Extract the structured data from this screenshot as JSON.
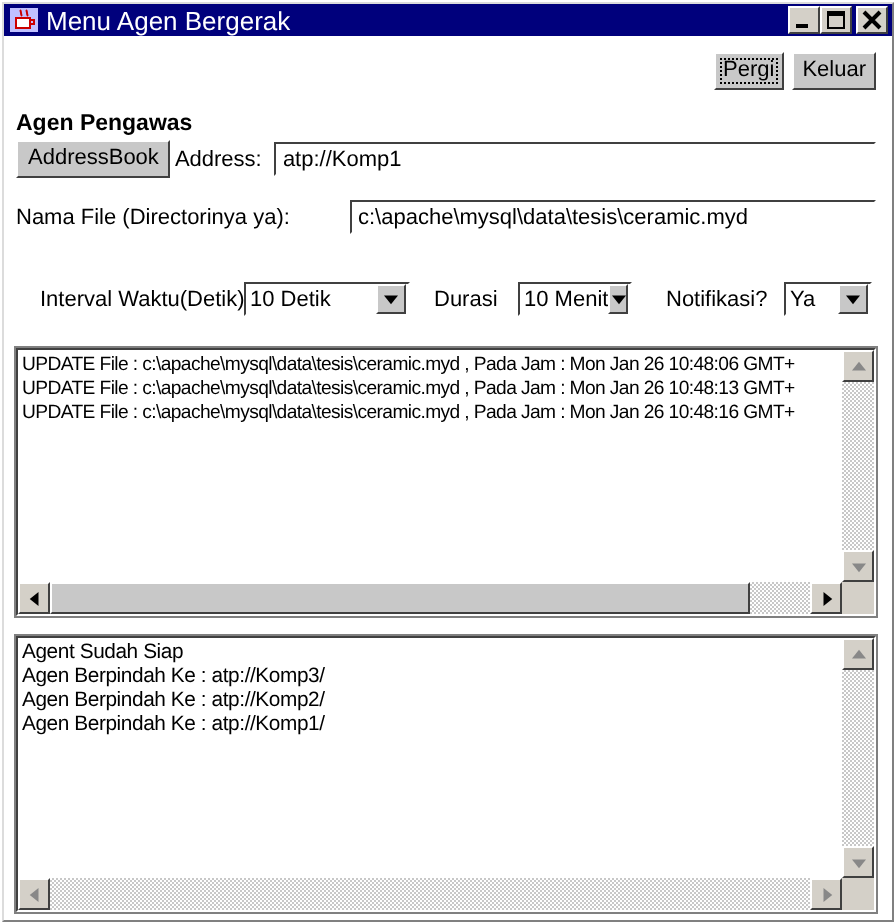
{
  "window": {
    "title": "Menu Agen Bergerak"
  },
  "buttons": [
    {
      "label": "Pergi",
      "focused": true
    },
    {
      "label": "Keluar",
      "focused": false
    }
  ],
  "section_title": "Agen Pengawas",
  "address": {
    "button": "AddressBook",
    "label": "Address:",
    "value": "atp://Komp1"
  },
  "file": {
    "label": "Nama File (Directorinya ya):",
    "value": "c:\\apache\\mysql\\data\\tesis\\ceramic.myd"
  },
  "settings": [
    {
      "label": "Interval Waktu(Detik)",
      "value": "10 Detik"
    },
    {
      "label": "Durasi",
      "value": "10 Menit"
    },
    {
      "label": "Notifikasi?",
      "value": "Ya"
    }
  ],
  "update_log": {
    "lines": [
      "UPDATE File : c:\\apache\\mysql\\data\\tesis\\ceramic.myd , Pada Jam : Mon Jan 26 10:48:06 GMT+",
      "UPDATE File : c:\\apache\\mysql\\data\\tesis\\ceramic.myd , Pada Jam : Mon Jan 26 10:48:13 GMT+",
      "UPDATE File : c:\\apache\\mysql\\data\\tesis\\ceramic.myd , Pada Jam : Mon Jan 26 10:48:16 GMT+"
    ]
  },
  "agent_log": {
    "lines": [
      "Agent Sudah Siap",
      "Agen Berpindah Ke : atp://Komp3/",
      "Agen Berpindah Ke : atp://Komp2/",
      "Agen Berpindah Ke : atp://Komp1/"
    ]
  }
}
